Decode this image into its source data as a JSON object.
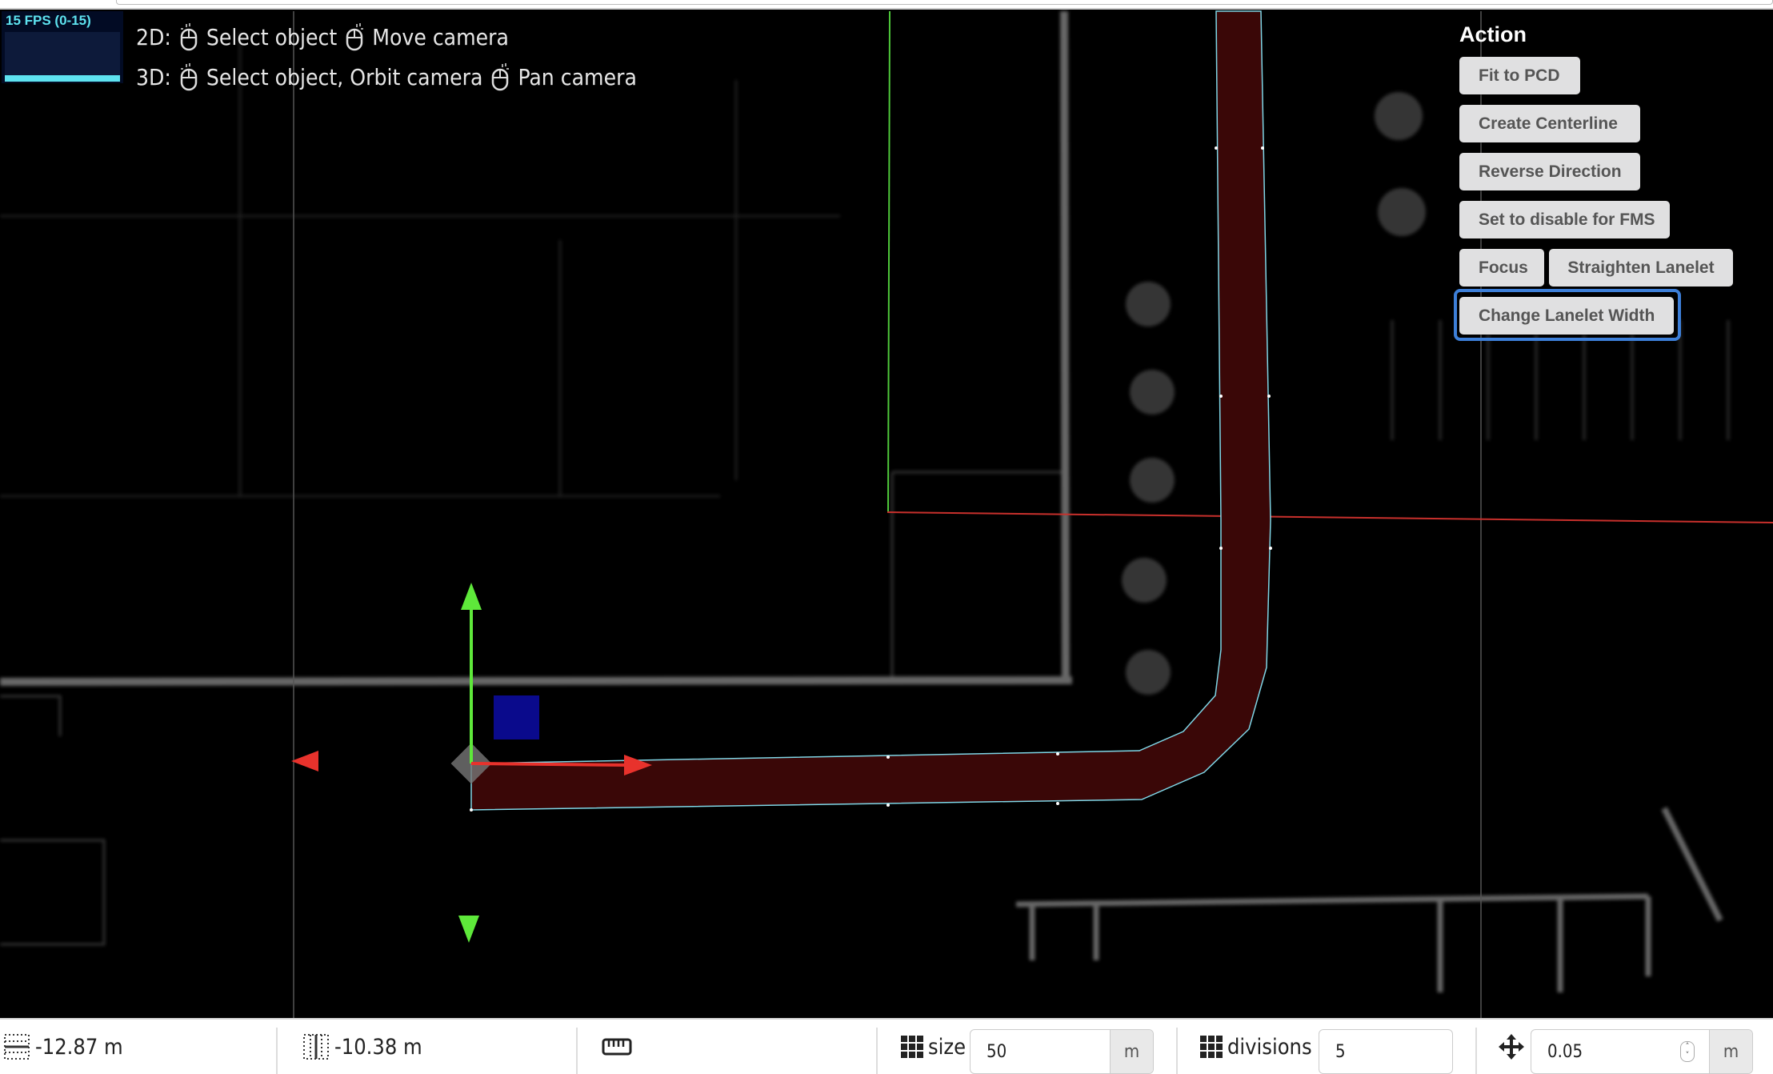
{
  "fps": {
    "label": "15 FPS (0-15)"
  },
  "hints": {
    "row2d": {
      "prefix": "2D:",
      "left_action": "Select object",
      "right_action": "Move camera"
    },
    "row3d": {
      "prefix": "3D:",
      "left_action": "Select object, Orbit camera",
      "right_action": "Pan camera"
    }
  },
  "action_panel": {
    "title": "Action",
    "buttons": [
      "Fit to PCD",
      "Create Centerline",
      "Reverse Direction",
      "Set to disable for FMS",
      "Focus",
      "Straighten Lanelet",
      "Change Lanelet Width"
    ],
    "focused": "Change Lanelet Width"
  },
  "colors": {
    "lanelet_fill": "#3a0707",
    "lanelet_edge": "#7fd6e6",
    "axis_x": "#e8322c",
    "axis_y": "#5ee83a",
    "axis_z": "#0a0a8c",
    "focus_ring": "#3d7fd8"
  },
  "bottom_bar": {
    "x_coord": "-12.87 m",
    "y_coord": "-10.38 m",
    "ruler_icon": "ruler-icon",
    "grid_size": {
      "label": "size",
      "value": "50",
      "unit": "m"
    },
    "grid_divisions": {
      "label": "divisions",
      "value": "5"
    },
    "move_step": {
      "value": "0.05",
      "unit": "m"
    }
  }
}
